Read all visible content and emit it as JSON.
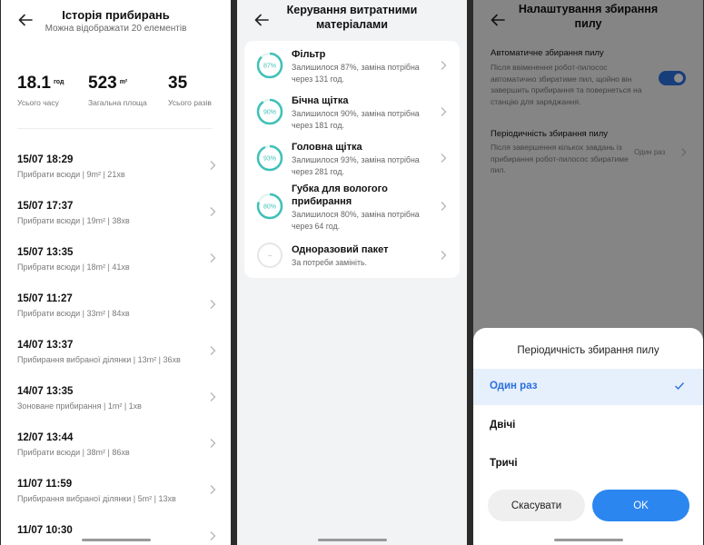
{
  "history": {
    "title": "Історія прибирань",
    "subtitle": "Можна відображати 20 елементів",
    "stats": [
      {
        "value": "18.1",
        "unit": "год",
        "label": "Усього часу"
      },
      {
        "value": "523",
        "unit": "m²",
        "label": "Загальна площа"
      },
      {
        "value": "35",
        "unit": "",
        "label": "Усього разів"
      }
    ],
    "items": [
      {
        "datetime": "15/07 18:29",
        "details": "Прибрати всюди | 9m² | 21хв"
      },
      {
        "datetime": "15/07 17:37",
        "details": "Прибрати всюди | 19m² | 38хв"
      },
      {
        "datetime": "15/07 13:35",
        "details": "Прибрати всюди | 18m² | 41хв"
      },
      {
        "datetime": "15/07 11:27",
        "details": "Прибрати всюди | 33m² | 84хв"
      },
      {
        "datetime": "14/07 13:37",
        "details": "Прибирання вибраної ділянки | 13m² | 36хв"
      },
      {
        "datetime": "14/07 13:35",
        "details": "Зоноване прибирання | 1m² | 1хв"
      },
      {
        "datetime": "12/07 13:44",
        "details": "Прибрати всюди | 38m² | 86хв"
      },
      {
        "datetime": "11/07 11:59",
        "details": "Прибирання вибраної ділянки | 5m² | 13хв"
      },
      {
        "datetime": "11/07 10:30",
        "details": ""
      }
    ]
  },
  "consumables": {
    "title": "Керування витратними матеріалами",
    "items": [
      {
        "name": "Фільтр",
        "percent_label": "87%",
        "percent": 87,
        "desc": "Залишилося 87%, заміна потрібна через 131 год."
      },
      {
        "name": "Бічна щітка",
        "percent_label": "90%",
        "percent": 90,
        "desc": "Залишилося 90%, заміна потрібна через 181 год."
      },
      {
        "name": "Головна щітка",
        "percent_label": "93%",
        "percent": 93,
        "desc": "Залишилося 93%, заміна потрібна через 281 год."
      },
      {
        "name": "Губка для вологого прибирання",
        "percent_label": "80%",
        "percent": 80,
        "desc": "Залишилося 80%, заміна потрібна через 64 год."
      },
      {
        "name": "Одноразовий пакет",
        "percent_label": "--",
        "percent": 0,
        "desc": "За потреби замініть."
      }
    ],
    "ring_color": "#3fc1b8"
  },
  "dust": {
    "title": "Налаштування збирання пилу",
    "auto": {
      "name": "Автоматичне збирання пилу",
      "desc": "Після ввімкнення робот-пилосос автоматично збиратиме пил, щойно він завершить прибирання та повернеться на станцію для заряджання.",
      "enabled": true
    },
    "freq": {
      "name": "Періодичність збирання пилу",
      "desc": "Після завершення кількох завдань із прибирання робот-пилосос збиратиме пил.",
      "value": "Один раз"
    },
    "sheet": {
      "title": "Періодичність збирання пилу",
      "options": [
        "Один раз",
        "Двічі",
        "Тричі"
      ],
      "selected": "Один раз",
      "cancel": "Скасувати",
      "ok": "OK"
    },
    "accent": "#2a6fe0"
  }
}
